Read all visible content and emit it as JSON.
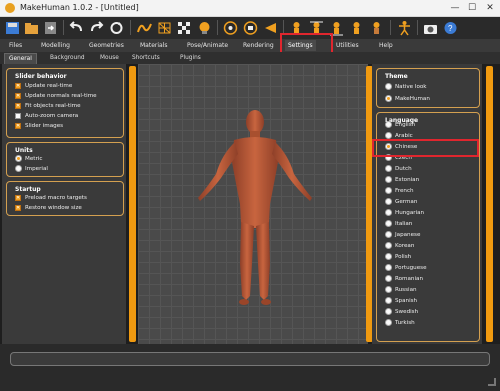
{
  "window": {
    "title": "MakeHuman 1.0.2 - [Untitled]",
    "minimize": "—",
    "maximize": "☐",
    "close": "✕"
  },
  "toolbar": {
    "icons": [
      "undo-icon",
      "redo-icon",
      "reset-icon",
      "smooth-icon",
      "wireframe-icon",
      "background-icon",
      "pose-icon",
      "front-view-icon",
      "back-view-icon",
      "left-view-icon",
      "right-view-icon",
      "top-view-icon",
      "bottom-view-icon",
      "skeleton-icon",
      "screenshot-icon",
      "help-icon"
    ]
  },
  "main_tabs": [
    "Files",
    "Modelling",
    "Geometries",
    "Materials",
    "Pose/Animate",
    "Rendering",
    "Settings",
    "Utilities",
    "Help"
  ],
  "active_main_tab": "Settings",
  "sub_tabs": [
    "General",
    "Background",
    "Mouse",
    "Shortcuts",
    "Plugins"
  ],
  "active_sub_tab": "General",
  "left": {
    "slider_behavior": {
      "title": "Slider behavior",
      "items": [
        {
          "label": "Update real-time",
          "checked": true
        },
        {
          "label": "Update normals real-time",
          "checked": true
        },
        {
          "label": "Fit objects real-time",
          "checked": true
        },
        {
          "label": "Auto-zoom camera",
          "checked": false
        },
        {
          "label": "Slider images",
          "checked": true
        }
      ]
    },
    "units": {
      "title": "Units",
      "items": [
        {
          "label": "Metric",
          "selected": true
        },
        {
          "label": "Imperial",
          "selected": false
        }
      ]
    },
    "startup": {
      "title": "Startup",
      "items": [
        {
          "label": "Preload macro targets",
          "checked": true
        },
        {
          "label": "Restore window size",
          "checked": true
        }
      ]
    }
  },
  "right": {
    "theme": {
      "title": "Theme",
      "items": [
        {
          "label": "Native look",
          "selected": false
        },
        {
          "label": "MakeHuman",
          "selected": true
        }
      ]
    },
    "language": {
      "title": "Language",
      "items": [
        "English",
        "Arabic",
        "Chinese",
        "Czech",
        "Dutch",
        "Estonian",
        "French",
        "German",
        "Hungarian",
        "Italian",
        "Japanese",
        "Korean",
        "Polish",
        "Portuguese",
        "Romanian",
        "Russian",
        "Spanish",
        "Swedish",
        "Turkish"
      ],
      "selected": "Chinese"
    }
  },
  "colors": {
    "accent": "#f09a10",
    "highlight": "#e0262e",
    "panel": "#3a3a3a",
    "skin": "#b8573a"
  }
}
